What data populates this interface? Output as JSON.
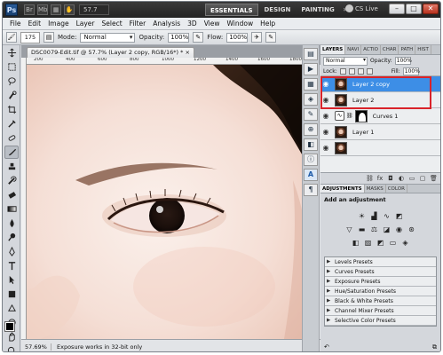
{
  "app": {
    "logo": "Ps",
    "zoom": "57.7",
    "workspaces": [
      "ESSENTIALS",
      "DESIGN",
      "PAINTING"
    ],
    "active_workspace": "ESSENTIALS",
    "more": "»",
    "cs_live": "CS Live",
    "win_minimize": "–",
    "win_maximize": "□",
    "win_close": "✕"
  },
  "menu": [
    "File",
    "Edit",
    "Image",
    "Layer",
    "Select",
    "Filter",
    "Analysis",
    "3D",
    "View",
    "Window",
    "Help"
  ],
  "options": {
    "brush_size": "175",
    "mode_label": "Mode:",
    "mode_value": "Normal",
    "opacity_label": "Opacity:",
    "opacity_value": "100%",
    "flow_label": "Flow:",
    "flow_value": "100%"
  },
  "document": {
    "tab_title": "DSC0079-Edit.tif @ 57.7% (Layer 2 copy, RGB/16*) *",
    "tab_close": "×",
    "ruler_marks": [
      "200",
      "400",
      "600",
      "800",
      "1000",
      "1200",
      "1400",
      "1600",
      "1800"
    ],
    "status_zoom": "57.69%",
    "status_message": "Exposure works in 32-bit only"
  },
  "layers_panel": {
    "tabs": [
      "LAYERS",
      "NAVI",
      "ACTIO",
      "CHAR",
      "PATH",
      "HIST"
    ],
    "blend_mode": "Normal",
    "opacity_label": "Opacity:",
    "opacity_value": "100%",
    "lock_label": "Lock:",
    "fill_label": "Fill:",
    "fill_value": "100%",
    "layers": [
      {
        "name": "Layer 2 copy",
        "selected": true,
        "type": "image"
      },
      {
        "name": "Layer 2",
        "selected": false,
        "type": "image"
      },
      {
        "name": "Curves 1",
        "selected": false,
        "type": "adjustment"
      },
      {
        "name": "Layer 1",
        "selected": false,
        "type": "image"
      },
      {
        "name": "",
        "selected": false,
        "type": "image"
      }
    ],
    "highlight_color": "#d9232a",
    "selected_color": "#3d8ee6"
  },
  "adjustments_panel": {
    "tabs": [
      "ADJUSTMENTS",
      "MASKS",
      "COLOR"
    ],
    "title": "Add an adjustment",
    "presets": [
      "Levels Presets",
      "Curves Presets",
      "Exposure Presets",
      "Hue/Saturation Presets",
      "Black & White Presets",
      "Channel Mixer Presets",
      "Selective Color Presets"
    ]
  }
}
